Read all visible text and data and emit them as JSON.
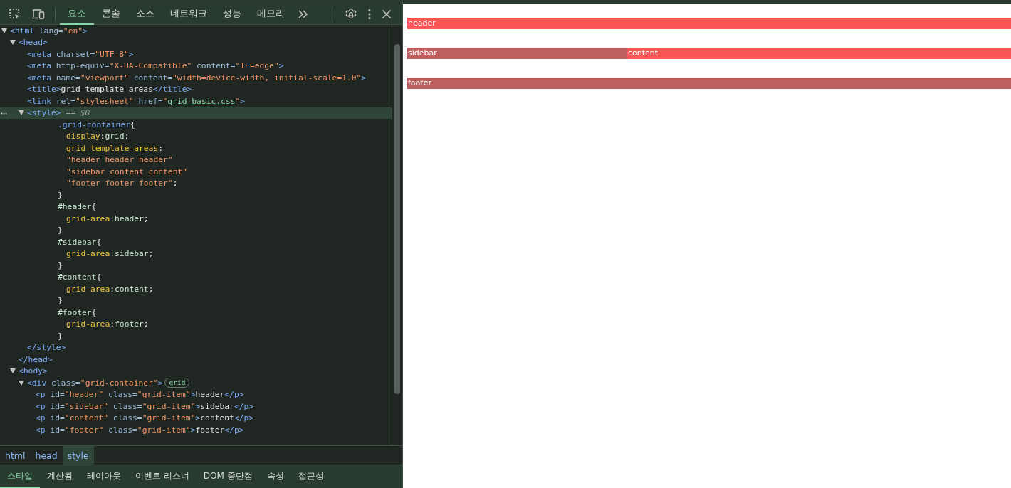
{
  "toolbar": {
    "tabs": [
      {
        "label": "요소",
        "selected": true
      },
      {
        "label": "콘솔",
        "selected": false
      },
      {
        "label": "소스",
        "selected": false
      },
      {
        "label": "네트워크",
        "selected": false
      },
      {
        "label": "성능",
        "selected": false
      },
      {
        "label": "메모리",
        "selected": false
      }
    ]
  },
  "dom_tree": [
    {
      "selected": false,
      "expanded": true,
      "tokens": [
        {
          "kind": "tag",
          "text": "<html"
        },
        {
          "kind": "attr",
          "text": " lang="
        },
        {
          "kind": "value",
          "text": "\"en\""
        },
        {
          "kind": "tag",
          "text": ">"
        }
      ],
      "children": [
        {
          "selected": false,
          "expanded": true,
          "tokens": [
            {
              "kind": "tag",
              "text": "<head>"
            }
          ],
          "children": [
            {
              "selected": false,
              "tokens": [
                {
                  "kind": "tag",
                  "text": "<meta"
                },
                {
                  "kind": "attr",
                  "text": " charset="
                },
                {
                  "kind": "value",
                  "text": "\"UTF-8\""
                },
                {
                  "kind": "tag",
                  "text": ">"
                }
              ]
            },
            {
              "selected": false,
              "tokens": [
                {
                  "kind": "tag",
                  "text": "<meta"
                },
                {
                  "kind": "attr",
                  "text": " http-equiv="
                },
                {
                  "kind": "value",
                  "text": "\"X-UA-Compatible\""
                },
                {
                  "kind": "attr",
                  "text": " content="
                },
                {
                  "kind": "value",
                  "text": "\"IE=edge\""
                },
                {
                  "kind": "tag",
                  "text": ">"
                }
              ]
            },
            {
              "selected": false,
              "tokens": [
                {
                  "kind": "tag",
                  "text": "<meta"
                },
                {
                  "kind": "attr",
                  "text": " name="
                },
                {
                  "kind": "value",
                  "text": "\"viewport\""
                },
                {
                  "kind": "attr",
                  "text": " content="
                },
                {
                  "kind": "value",
                  "text": "\"width=device-width, initial-scale=1.0\""
                },
                {
                  "kind": "tag",
                  "text": ">"
                }
              ]
            },
            {
              "selected": false,
              "tokens": [
                {
                  "kind": "tag",
                  "text": "<title>"
                },
                {
                  "kind": "text",
                  "text": "grid-template-areas"
                },
                {
                  "kind": "tag",
                  "text": "</title>"
                }
              ]
            },
            {
              "selected": false,
              "tokens": [
                {
                  "kind": "tag",
                  "text": "<link"
                },
                {
                  "kind": "attr",
                  "text": " rel="
                },
                {
                  "kind": "value",
                  "text": "\"stylesheet\""
                },
                {
                  "kind": "attr",
                  "text": " href="
                },
                {
                  "kind": "value",
                  "text": "\""
                },
                {
                  "kind": "link",
                  "text": "grid-basic.css"
                },
                {
                  "kind": "value",
                  "text": "\""
                },
                {
                  "kind": "tag",
                  "text": ">"
                }
              ]
            },
            {
              "selected": true,
              "expanded": true,
              "tokens": [
                {
                  "kind": "tag",
                  "text": "<style>"
                },
                {
                  "kind": "comment",
                  "text": " == $0"
                }
              ],
              "children": [
                {
                  "selected": false,
                  "kind": "css",
                  "tokens": [
                    {
                      "kind": "selector",
                      "text": ".grid-container"
                    },
                    {
                      "kind": "text",
                      "text": "{"
                    }
                  ],
                  "children": [
                    {
                      "selected": false,
                      "kind": "css",
                      "tokens": [
                        {
                          "kind": "prop",
                          "text": "display"
                        },
                        {
                          "kind": "text",
                          "text": ":"
                        },
                        {
                          "kind": "cssval",
                          "text": "grid"
                        },
                        {
                          "kind": "text",
                          "text": ";"
                        }
                      ]
                    },
                    {
                      "selected": false,
                      "kind": "css",
                      "tokens": [
                        {
                          "kind": "prop",
                          "text": "grid-template-areas"
                        },
                        {
                          "kind": "text",
                          "text": ":"
                        }
                      ]
                    },
                    {
                      "selected": false,
                      "kind": "css",
                      "tokens": [
                        {
                          "kind": "value",
                          "text": "\"header header header\""
                        }
                      ]
                    },
                    {
                      "selected": false,
                      "kind": "css",
                      "tokens": [
                        {
                          "kind": "value",
                          "text": "\"sidebar content content\""
                        }
                      ]
                    },
                    {
                      "selected": false,
                      "kind": "css",
                      "tokens": [
                        {
                          "kind": "value",
                          "text": "\"footer footer footer\""
                        },
                        {
                          "kind": "text",
                          "text": ";"
                        }
                      ]
                    }
                  ]
                },
                {
                  "selected": false,
                  "kind": "css",
                  "tokens": [
                    {
                      "kind": "text",
                      "text": "}"
                    }
                  ]
                },
                {
                  "selected": false,
                  "kind": "css",
                  "tokens": [
                    {
                      "kind": "idsel",
                      "text": "#header"
                    },
                    {
                      "kind": "text",
                      "text": "{"
                    }
                  ],
                  "children": [
                    {
                      "selected": false,
                      "kind": "css",
                      "tokens": [
                        {
                          "kind": "prop",
                          "text": "grid-area"
                        },
                        {
                          "kind": "text",
                          "text": ":"
                        },
                        {
                          "kind": "cssval",
                          "text": "header"
                        },
                        {
                          "kind": "text",
                          "text": ";"
                        }
                      ]
                    }
                  ]
                },
                {
                  "selected": false,
                  "kind": "css",
                  "tokens": [
                    {
                      "kind": "text",
                      "text": "}"
                    }
                  ]
                },
                {
                  "selected": false,
                  "kind": "css",
                  "tokens": [
                    {
                      "kind": "idsel",
                      "text": "#sidebar"
                    },
                    {
                      "kind": "text",
                      "text": "{"
                    }
                  ],
                  "children": [
                    {
                      "selected": false,
                      "kind": "css",
                      "tokens": [
                        {
                          "kind": "prop",
                          "text": "grid-area"
                        },
                        {
                          "kind": "text",
                          "text": ":"
                        },
                        {
                          "kind": "cssval",
                          "text": "sidebar"
                        },
                        {
                          "kind": "text",
                          "text": ";"
                        }
                      ]
                    }
                  ]
                },
                {
                  "selected": false,
                  "kind": "css",
                  "tokens": [
                    {
                      "kind": "text",
                      "text": "}"
                    }
                  ]
                },
                {
                  "selected": false,
                  "kind": "css",
                  "tokens": [
                    {
                      "kind": "idsel",
                      "text": "#content"
                    },
                    {
                      "kind": "text",
                      "text": "{"
                    }
                  ],
                  "children": [
                    {
                      "selected": false,
                      "kind": "css",
                      "tokens": [
                        {
                          "kind": "prop",
                          "text": "grid-area"
                        },
                        {
                          "kind": "text",
                          "text": ":"
                        },
                        {
                          "kind": "cssval",
                          "text": "content"
                        },
                        {
                          "kind": "text",
                          "text": ";"
                        }
                      ]
                    }
                  ]
                },
                {
                  "selected": false,
                  "kind": "css",
                  "tokens": [
                    {
                      "kind": "text",
                      "text": "}"
                    }
                  ]
                },
                {
                  "selected": false,
                  "kind": "css",
                  "tokens": [
                    {
                      "kind": "idsel",
                      "text": "#footer"
                    },
                    {
                      "kind": "text",
                      "text": "{"
                    }
                  ],
                  "children": [
                    {
                      "selected": false,
                      "kind": "css",
                      "tokens": [
                        {
                          "kind": "prop",
                          "text": "grid-area"
                        },
                        {
                          "kind": "text",
                          "text": ":"
                        },
                        {
                          "kind": "cssval",
                          "text": "footer"
                        },
                        {
                          "kind": "text",
                          "text": ";"
                        }
                      ]
                    }
                  ]
                },
                {
                  "selected": false,
                  "kind": "css",
                  "tokens": [
                    {
                      "kind": "text",
                      "text": "}"
                    }
                  ]
                }
              ]
            },
            {
              "selected": false,
              "tokens": [
                {
                  "kind": "tag",
                  "text": "</style>"
                }
              ]
            }
          ]
        },
        {
          "selected": false,
          "tokens": [
            {
              "kind": "tag",
              "text": "</head>"
            }
          ]
        },
        {
          "selected": false,
          "expanded": true,
          "tokens": [
            {
              "kind": "tag",
              "text": "<body>"
            }
          ],
          "children": [
            {
              "selected": false,
              "expanded": true,
              "badge": "grid",
              "tokens": [
                {
                  "kind": "tag",
                  "text": "<div"
                },
                {
                  "kind": "attr",
                  "text": " class="
                },
                {
                  "kind": "value",
                  "text": "\"grid-container\""
                },
                {
                  "kind": "tag",
                  "text": ">"
                }
              ],
              "children": [
                {
                  "selected": false,
                  "tokens": [
                    {
                      "kind": "tag",
                      "text": "<p"
                    },
                    {
                      "kind": "attr",
                      "text": " id="
                    },
                    {
                      "kind": "value",
                      "text": "\"header\""
                    },
                    {
                      "kind": "attr",
                      "text": " class="
                    },
                    {
                      "kind": "value",
                      "text": "\"grid-item\""
                    },
                    {
                      "kind": "tag",
                      "text": ">"
                    },
                    {
                      "kind": "text",
                      "text": "header"
                    },
                    {
                      "kind": "tag",
                      "text": "</p>"
                    }
                  ]
                },
                {
                  "selected": false,
                  "tokens": [
                    {
                      "kind": "tag",
                      "text": "<p"
                    },
                    {
                      "kind": "attr",
                      "text": " id="
                    },
                    {
                      "kind": "value",
                      "text": "\"sidebar\""
                    },
                    {
                      "kind": "attr",
                      "text": " class="
                    },
                    {
                      "kind": "value",
                      "text": "\"grid-item\""
                    },
                    {
                      "kind": "tag",
                      "text": ">"
                    },
                    {
                      "kind": "text",
                      "text": "sidebar"
                    },
                    {
                      "kind": "tag",
                      "text": "</p>"
                    }
                  ]
                },
                {
                  "selected": false,
                  "tokens": [
                    {
                      "kind": "tag",
                      "text": "<p"
                    },
                    {
                      "kind": "attr",
                      "text": " id="
                    },
                    {
                      "kind": "value",
                      "text": "\"content\""
                    },
                    {
                      "kind": "attr",
                      "text": " class="
                    },
                    {
                      "kind": "value",
                      "text": "\"grid-item\""
                    },
                    {
                      "kind": "tag",
                      "text": ">"
                    },
                    {
                      "kind": "text",
                      "text": "content"
                    },
                    {
                      "kind": "tag",
                      "text": "</p>"
                    }
                  ]
                },
                {
                  "selected": false,
                  "tokens": [
                    {
                      "kind": "tag",
                      "text": "<p"
                    },
                    {
                      "kind": "attr",
                      "text": " id="
                    },
                    {
                      "kind": "value",
                      "text": "\"footer\""
                    },
                    {
                      "kind": "attr",
                      "text": " class="
                    },
                    {
                      "kind": "value",
                      "text": "\"grid-item\""
                    },
                    {
                      "kind": "tag",
                      "text": ">"
                    },
                    {
                      "kind": "text",
                      "text": "footer"
                    },
                    {
                      "kind": "tag",
                      "text": "</p>"
                    }
                  ]
                }
              ]
            }
          ]
        }
      ]
    }
  ],
  "breadcrumbs": [
    {
      "label": "html",
      "selected": false
    },
    {
      "label": "head",
      "selected": false
    },
    {
      "label": "style",
      "selected": true
    }
  ],
  "panel_tabs": [
    {
      "label": "스타일",
      "selected": true
    },
    {
      "label": "계산됨",
      "selected": false
    },
    {
      "label": "레이아웃",
      "selected": false
    },
    {
      "label": "이벤트 리스너",
      "selected": false
    },
    {
      "label": "DOM 중단점",
      "selected": false
    },
    {
      "label": "속성",
      "selected": false
    },
    {
      "label": "접근성",
      "selected": false
    }
  ],
  "page": {
    "rows": [
      [
        {
          "text": "header",
          "color": "#fc5555"
        }
      ],
      [
        {
          "text": "sidebar",
          "color": "#bd5f5f"
        },
        {
          "text": "content",
          "color": "#fc5555"
        }
      ],
      [
        {
          "text": "footer",
          "color": "#bd5f5f"
        }
      ]
    ]
  }
}
